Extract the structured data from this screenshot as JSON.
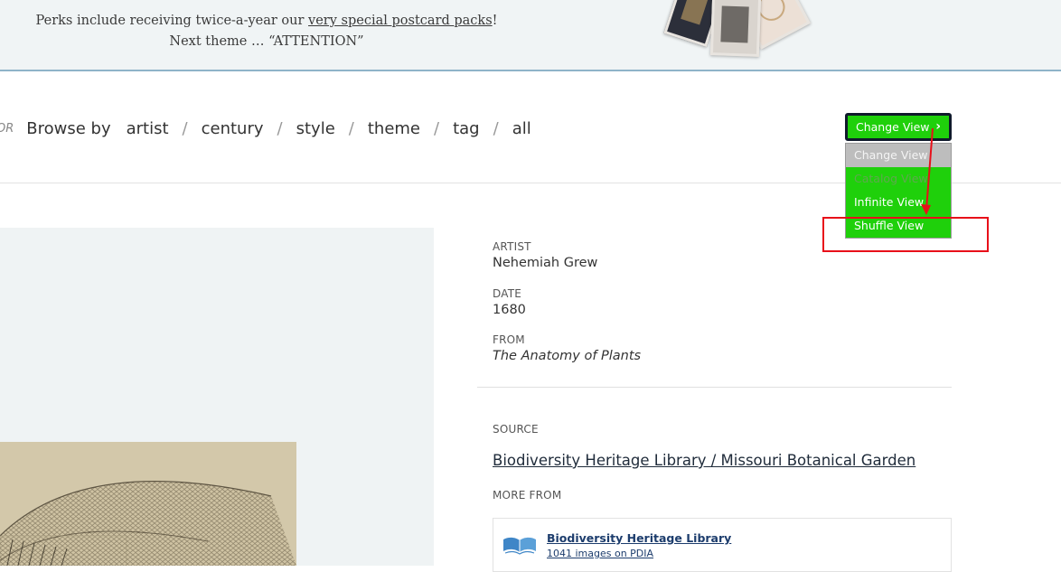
{
  "banner": {
    "line1_prefix": "Perks include receiving twice-a-year our ",
    "line1_link": "very special postcard packs",
    "line1_suffix": "!",
    "line2": "Next theme … “ATTENTION”"
  },
  "browse": {
    "or_label": "OR",
    "label": "Browse by",
    "links": [
      "artist",
      "century",
      "style",
      "theme",
      "tag",
      "all"
    ],
    "separator": "/"
  },
  "change_view": {
    "button_label": "Change View",
    "chevron": "›",
    "menu": [
      "Change View",
      "Catalog View",
      "Infinite View",
      "Shuffle View"
    ]
  },
  "details": {
    "artist_label": "ARTIST",
    "artist": "Nehemiah Grew",
    "date_label": "DATE",
    "date": "1680",
    "from_label": "FROM",
    "from": "The Anatomy of Plants",
    "source_label": "SOURCE",
    "source": "Biodiversity Heritage Library / Missouri Botanical Garden",
    "more_from_label": "MORE FROM",
    "more_from_title": "Biodiversity Heritage Library",
    "more_from_count": "1041 images on PDIA"
  },
  "icons": {
    "book": "open-book-icon"
  },
  "colors": {
    "button_green": "#1fd00b",
    "highlight_red": "#e8101a",
    "banner_bg": "#f0f4f5",
    "panel_bg": "#eff3f4"
  }
}
